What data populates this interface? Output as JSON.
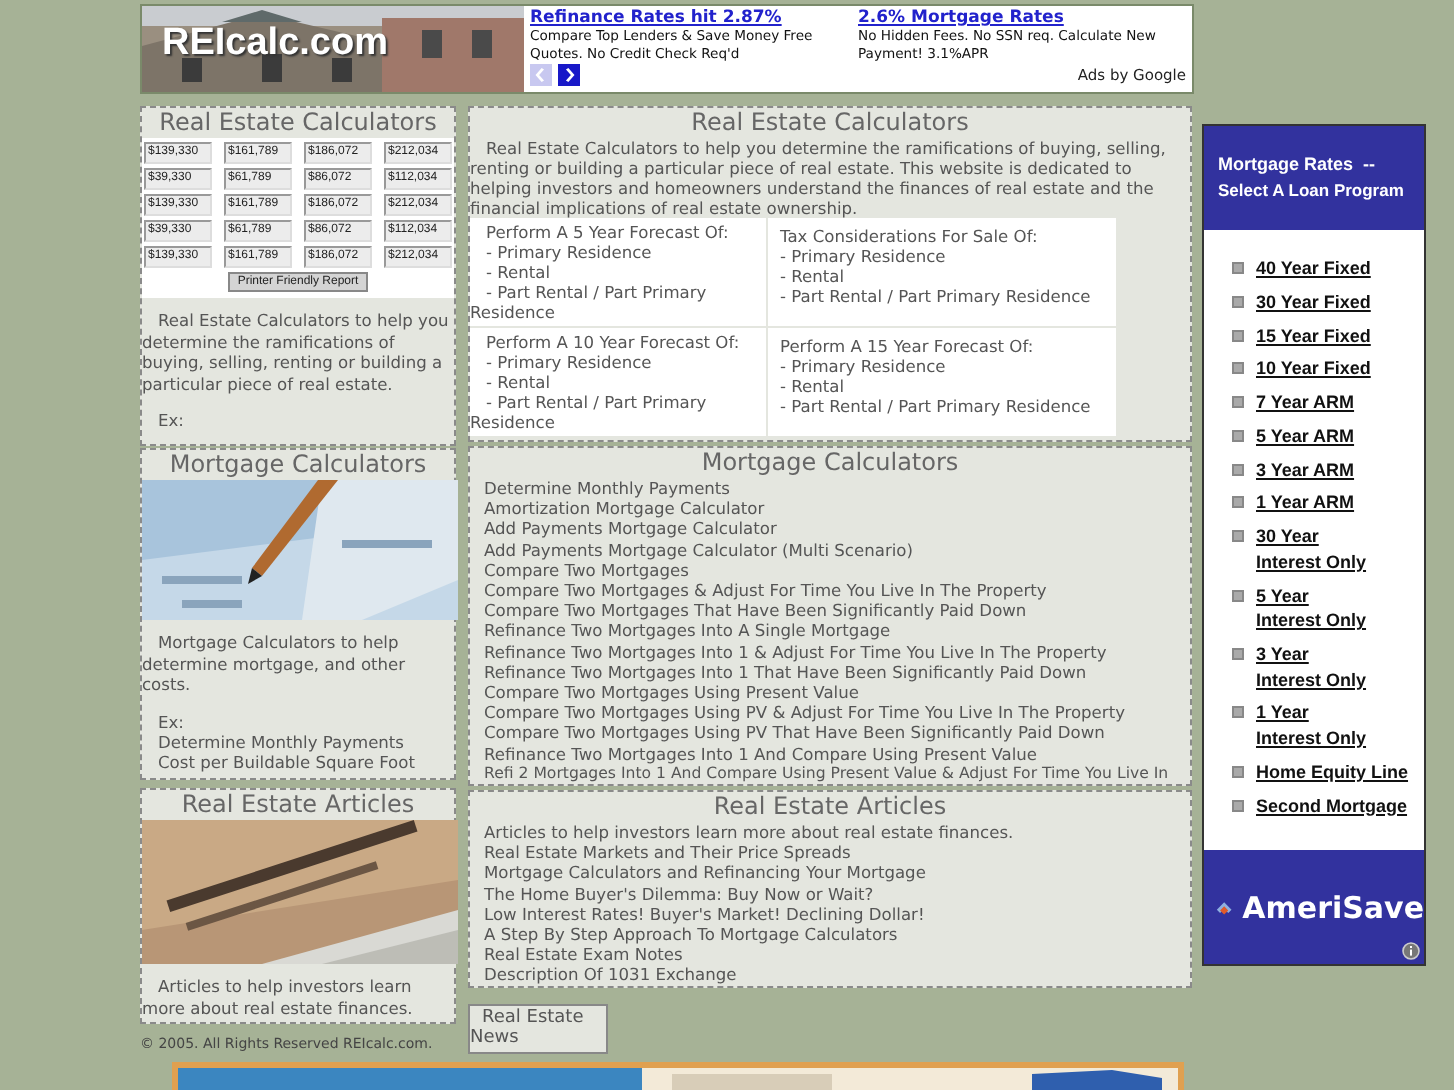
{
  "header": {
    "logo": "REIcalc.com",
    "ads": [
      {
        "title": "Refinance Rates hit 2.87%",
        "text": "Compare Top Lenders & Save Money Free Quotes. No Credit Check Req'd"
      },
      {
        "title": "2.6% Mortgage Rates",
        "text": "No Hidden Fees. No SSN req. Calculate New Payment! 3.1%APR"
      }
    ],
    "nav": [
      {
        "kind": "prev",
        "disabled": true
      },
      {
        "kind": "next",
        "disabled": false
      }
    ],
    "ads_by": "Ads by Google"
  },
  "left": {
    "calculators": {
      "title": "Real Estate Calculators",
      "values": [
        [
          "$139,330",
          "$161,789",
          "$186,072",
          "$212,034"
        ],
        [
          "$39,330",
          "$61,789",
          "$86,072",
          "$112,034"
        ],
        [
          "$139,330",
          "$161,789",
          "$186,072",
          "$212,034"
        ],
        [
          "$39,330",
          "$61,789",
          "$86,072",
          "$112,034"
        ],
        [
          "$139,330",
          "$161,789",
          "$186,072",
          "$212,034"
        ]
      ],
      "button": "Printer Friendly Report",
      "text": "Real Estate Calculators to help you determine the ramifications of buying, selling, renting or building a particular piece of real estate.",
      "ex": "Ex:"
    },
    "mortgage": {
      "title": "Mortgage Calculators",
      "text": "Mortgage Calculators to help determine mortgage, and other costs.",
      "ex": "Ex:",
      "examples": [
        "Determine Monthly Payments",
        "Cost per Buildable Square Foot"
      ]
    },
    "articles": {
      "title": "Real Estate Articles",
      "text": "Articles to help investors learn more about real estate finances."
    },
    "copyright": "© 2005. All Rights Reserved REIcalc.com."
  },
  "main": {
    "calculators": {
      "title": "Real Estate Calculators",
      "intro": "Real Estate Calculators to help you determine the ramifications of buying, selling, renting or building a particular piece of real estate. This website is dedicated to helping investors and homeowners understand the finances of real estate and the financial implications of real estate ownership.",
      "cells": [
        {
          "heading": "Perform A 5 Year Forecast Of:",
          "items": [
            "- Primary Residence",
            "- Rental",
            "- Part Rental / Part Primary Residence"
          ]
        },
        {
          "heading": "Tax Considerations For Sale Of:",
          "items": [
            "- Primary Residence",
            "- Rental",
            "- Part Rental / Part Primary Residence"
          ]
        },
        {
          "heading": "Perform A 10 Year Forecast Of:",
          "items": [
            "- Primary Residence",
            "- Rental",
            "- Part Rental / Part Primary Residence"
          ]
        },
        {
          "heading": "Perform A 15 Year Forecast Of:",
          "items": [
            "- Primary Residence",
            "- Rental",
            "- Part Rental / Part Primary Residence"
          ]
        }
      ]
    },
    "mortgage": {
      "title": "Mortgage Calculators",
      "links": [
        "Determine Monthly Payments",
        "Amortization Mortgage Calculator",
        "Add Payments Mortgage Calculator",
        "Add Payments Mortgage Calculator (Multi Scenario)",
        "Compare Two Mortgages",
        "Compare Two Mortgages & Adjust For Time You Live In The Property",
        "Compare Two Mortgages That Have Been Significantly Paid Down",
        "Refinance Two Mortgages Into A Single Mortgage",
        "Refinance Two Mortgages Into 1 & Adjust For Time You Live In The Property",
        "Refinance Two Mortgages Into 1 That Have Been Significantly Paid Down",
        "Compare Two Mortgages Using Present Value",
        "Compare Two Mortgages Using PV & Adjust For Time You Live In The Property",
        "Compare Two Mortgages Using PV That Have Been Significantly Paid Down",
        "Refinance Two Mortgages Into 1 And Compare Using Present Value",
        "Refi 2 Mortgages Into 1 And Compare Using Present Value & Adjust For Time You Live In"
      ]
    },
    "articles": {
      "title": "Real Estate Articles",
      "intro": "Articles to help investors learn more about real estate finances.",
      "links": [
        "Real Estate Markets and Their Price Spreads",
        "Mortgage Calculators and Refinancing Your Mortgage",
        "The Home Buyer's Dilemma: Buy Now or Wait?",
        "Low Interest Rates! Buyer's Market! Declining Dollar!",
        "A Step By Step Approach To Mortgage Calculators",
        "Real Estate Exam Notes",
        "Description Of 1031 Exchange"
      ]
    },
    "news_button": "Real Estate News"
  },
  "rates": {
    "title": "Mortgage Rates  --",
    "subtitle": "Select A Loan Program",
    "links": [
      "40 Year Fixed",
      "30 Year Fixed",
      "15 Year Fixed",
      "10 Year Fixed",
      "7 Year ARM",
      "5 Year ARM",
      "3 Year ARM",
      "1 Year ARM",
      "30 Year\nInterest Only",
      "5 Year\nInterest Only",
      "3 Year\nInterest Only",
      "1 Year\nInterest Only",
      "Home Equity Line",
      "Second Mortgage"
    ],
    "brand": "AmeriSave"
  }
}
